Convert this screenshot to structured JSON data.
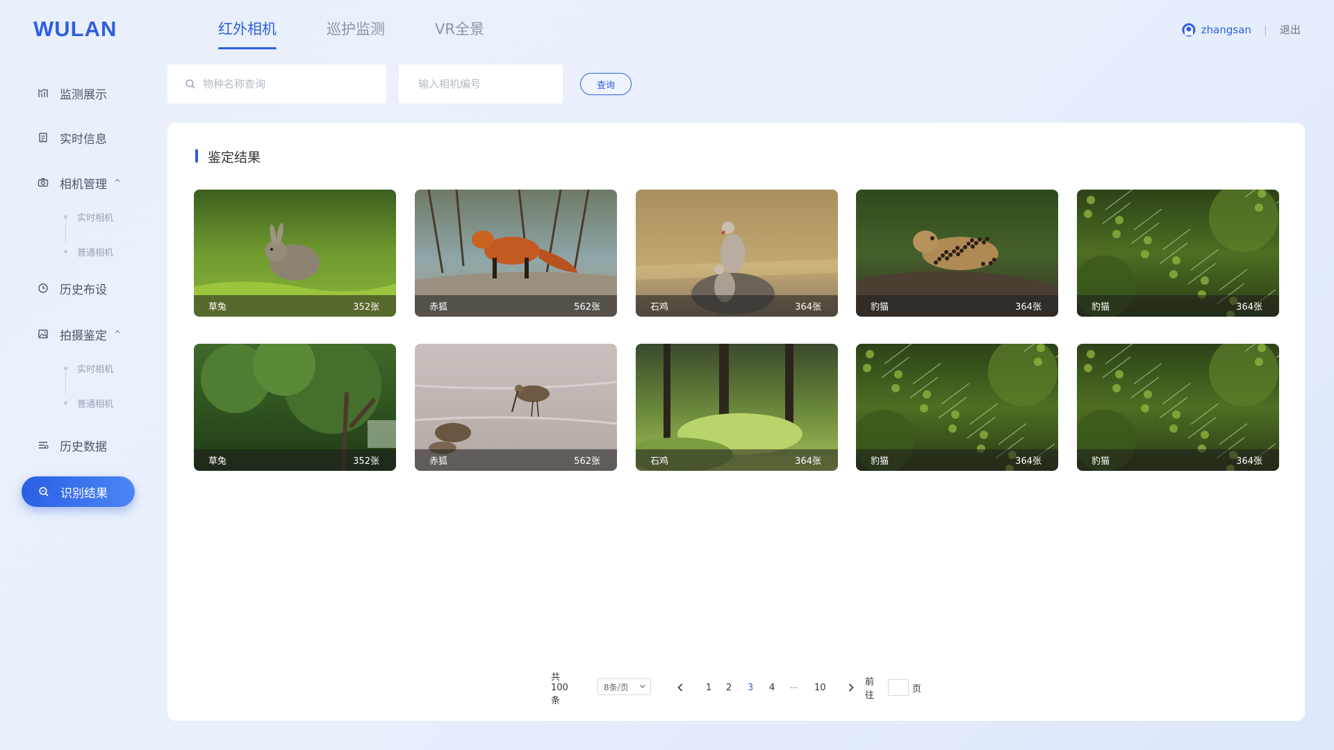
{
  "app": {
    "logo": "WULAN"
  },
  "header": {
    "tabs": [
      {
        "label": "红外相机",
        "active": true
      },
      {
        "label": "巡护监测",
        "active": false
      },
      {
        "label": "VR全景",
        "active": false
      }
    ],
    "user_name": "zhangsan",
    "separator": "|",
    "logout_label": "退出"
  },
  "sidebar": {
    "items": [
      {
        "label": "监测展示",
        "icon": "chart-icon"
      },
      {
        "label": "实时信息",
        "icon": "document-icon"
      },
      {
        "label": "相机管理",
        "icon": "camera-icon",
        "chevron": "^",
        "children": [
          "实时相机",
          "普通相机"
        ]
      },
      {
        "label": "历史布设",
        "icon": "clock-icon"
      },
      {
        "label": "拍摄鉴定",
        "icon": "image-icon",
        "chevron": "^",
        "children": [
          "实时相机",
          "普通相机"
        ]
      },
      {
        "label": "历史数据",
        "icon": "list-icon"
      },
      {
        "label": "识别结果",
        "icon": "search-icon",
        "active": true
      }
    ]
  },
  "search": {
    "species_placeholder": "物种名称查询",
    "camera_placeholder": "输入相机编号",
    "button_label": "查询"
  },
  "panel": {
    "title": "鉴定结果",
    "cards": [
      {
        "name": "草兔",
        "count": "352张",
        "scene": "rabbit"
      },
      {
        "name": "赤狐",
        "count": "562张",
        "scene": "fox"
      },
      {
        "name": "石鸡",
        "count": "364张",
        "scene": "partridge"
      },
      {
        "name": "豹猫",
        "count": "364张",
        "scene": "leopard-cat"
      },
      {
        "name": "豹猫",
        "count": "364张",
        "scene": "bush"
      },
      {
        "name": "草兔",
        "count": "352张",
        "scene": "forest"
      },
      {
        "name": "赤狐",
        "count": "562张",
        "scene": "shorebird"
      },
      {
        "name": "石鸡",
        "count": "364张",
        "scene": "woodland"
      },
      {
        "name": "豹猫",
        "count": "364张",
        "scene": "bush"
      },
      {
        "name": "豹猫",
        "count": "364张",
        "scene": "bush"
      }
    ]
  },
  "pagination": {
    "total": "共100条",
    "page_size": "8条/页",
    "pages": [
      "1",
      "2",
      "3",
      "4",
      "···",
      "10"
    ],
    "current_page": "3",
    "goto_label": "前往",
    "page_suffix": "页"
  },
  "colors": {
    "accent": "#2d5fe0",
    "muted_text": "#8a93a6",
    "background": "#e9f0fc"
  }
}
